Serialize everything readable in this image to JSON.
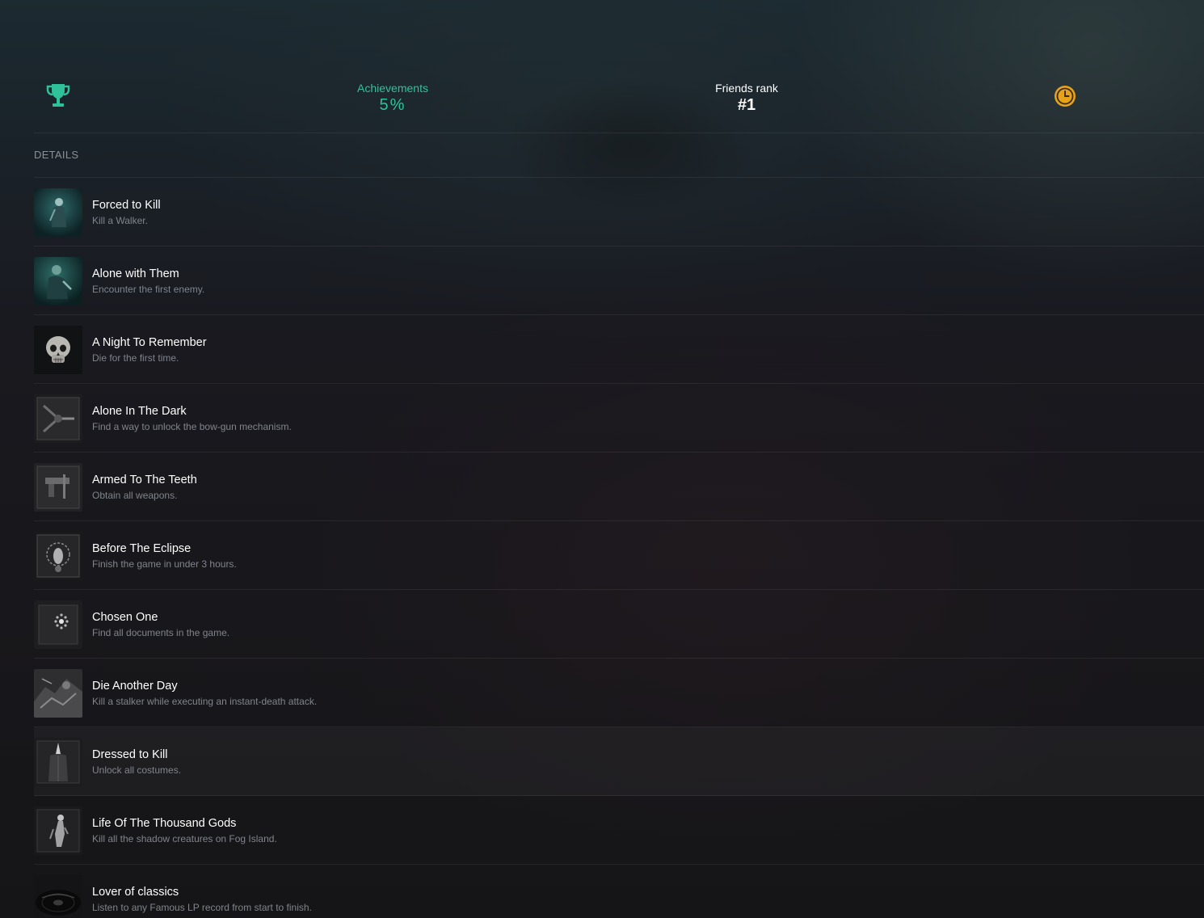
{
  "stats": {
    "trophy_icon": "trophy-icon",
    "achievements_label": "Achievements",
    "achievements_value": "5%",
    "friends_rank_label": "Friends rank",
    "friends_rank_value": "#1",
    "clock_icon": "clock-icon",
    "accent_color": "#2fc29a",
    "clock_color": "#e7a21c"
  },
  "details": {
    "label": "DETAILS"
  },
  "achievements": [
    {
      "title": "Forced to Kill",
      "description": "Kill a Walker.",
      "icon": "walker-figure-image"
    },
    {
      "title": "Alone with Them",
      "description": "Encounter the first enemy.",
      "icon": "enemy-figure-image"
    },
    {
      "title": "A Night To Remember",
      "description": "Die for the first time.",
      "icon": "skull-image"
    },
    {
      "title": "Alone In The Dark",
      "description": "Find a way to unlock the bow-gun mechanism.",
      "icon": "bow-gun-image"
    },
    {
      "title": "Armed To The Teeth",
      "description": "Obtain all weapons.",
      "icon": "weapons-image"
    },
    {
      "title": "Before The Eclipse",
      "description": "Finish the game in under 3 hours.",
      "icon": "eclipse-image"
    },
    {
      "title": "Chosen One",
      "description": "Find all documents in the game.",
      "icon": "document-image"
    },
    {
      "title": "Die Another Day",
      "description": "Kill a stalker while executing an instant-death attack.",
      "icon": "stalker-image"
    },
    {
      "title": "Dressed to Kill",
      "description": "Unlock all costumes.",
      "icon": "costume-image"
    },
    {
      "title": "Life Of The Thousand Gods",
      "description": "Kill all the shadow creatures on Fog Island.",
      "icon": "statue-image"
    },
    {
      "title": "Lover of classics",
      "description": "Listen to any Famous LP record from start to finish.",
      "icon": "lp-record-image"
    }
  ]
}
